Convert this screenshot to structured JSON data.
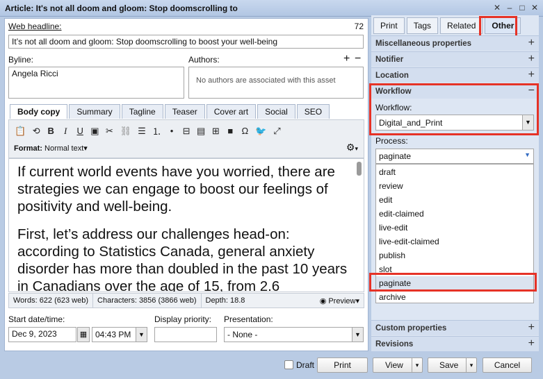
{
  "window": {
    "title": "Article: It's not all doom and gloom: Stop doomscrolling to",
    "controls": [
      "✕",
      "–",
      "□",
      "✕"
    ]
  },
  "headline": {
    "label": "Web headline:",
    "count": "72",
    "value": "It’s not all doom and gloom: Stop doomscrolling to boost your well-being"
  },
  "byline": {
    "label": "Byline:",
    "value": "Angela Ricci"
  },
  "authors": {
    "label": "Authors:",
    "empty": "No authors are associated with this asset",
    "add": "+",
    "remove": "−"
  },
  "editor_tabs": [
    "Body copy",
    "Summary",
    "Tagline",
    "Teaser",
    "Cover art",
    "Social",
    "SEO"
  ],
  "format": {
    "label": "Format:",
    "value": "Normal text▾"
  },
  "body": {
    "p1": "If current world events have you worried, there are strategies we can engage to boost our feelings of positivity and well-being.",
    "p2": "First, let’s address our challenges head-on: according to Statistics Canada, general anxiety disorder has more than doubled in the past 10 years in Canadians over the age of 15, from 2.6"
  },
  "status": {
    "words": "Words: 622 (623 web)",
    "chars": "Characters: 3856 (3866 web)",
    "depth": "Depth: 18.8",
    "preview": "Preview▾"
  },
  "start": {
    "label": "Start date/time:",
    "date": "Dec 9, 2023",
    "time": "04:43 PM"
  },
  "priority": {
    "label": "Display priority:",
    "value": ""
  },
  "presentation": {
    "label": "Presentation:",
    "value": "- None -"
  },
  "right_tabs": [
    "Print",
    "Tags",
    "Related",
    "Other"
  ],
  "sections": {
    "misc": "Miscellaneous properties",
    "notifier": "Notifier",
    "location": "Location",
    "workflow": "Workflow",
    "custom": "Custom properties",
    "revisions": "Revisions",
    "plus": "+",
    "minus": "−"
  },
  "workflow": {
    "label": "Workflow:",
    "value": "Digital_and_Print",
    "process_label": "Process:",
    "process_value": "paginate",
    "options": [
      "draft",
      "review",
      "edit",
      "edit-claimed",
      "live-edit",
      "live-edit-claimed",
      "publish",
      "slot",
      "paginate",
      "archive"
    ],
    "selected": "paginate"
  },
  "footer": {
    "draft": "Draft",
    "print": "Print",
    "view": "View",
    "save": "Save",
    "cancel": "Cancel"
  },
  "colors": {
    "highlight": "#e63226",
    "panel": "#dde6f3",
    "background": "#b9cbe4"
  }
}
